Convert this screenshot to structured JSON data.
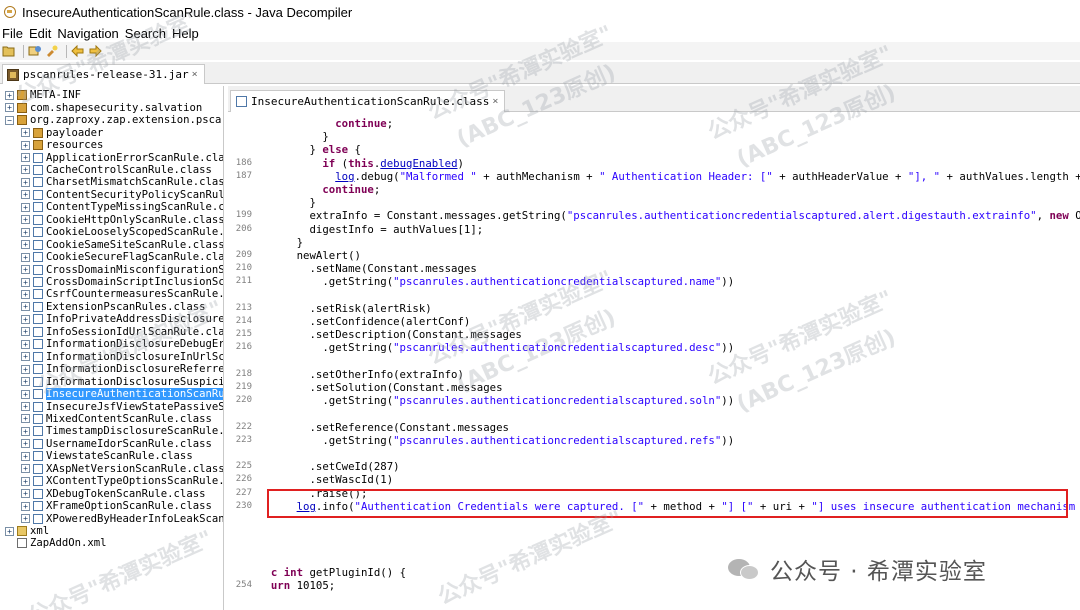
{
  "window": {
    "title": "InsecureAuthenticationScanRule.class - Java Decompiler"
  },
  "menu": {
    "items": [
      "File",
      "Edit",
      "Navigation",
      "Search",
      "Help"
    ]
  },
  "file_tab": {
    "label": "pscanrules-release-31.jar",
    "close": "×"
  },
  "tree": {
    "nodes": [
      {
        "label": "META-INF",
        "exp": "+",
        "icon": "package-icon"
      },
      {
        "label": "com.shapesecurity.salvation",
        "exp": "+",
        "icon": "package-icon"
      },
      {
        "label": "org.zaproxy.zap.extension.psca",
        "exp": "−",
        "icon": "package-icon"
      },
      {
        "label": "payloader",
        "exp": "+",
        "icon": "package-icon"
      },
      {
        "label": "resources",
        "exp": "+",
        "icon": "package-icon"
      },
      {
        "label": "ApplicationErrorScanRule.cla",
        "exp": "+",
        "icon": "class-icon"
      },
      {
        "label": "CacheControlScanRule.class",
        "exp": "+",
        "icon": "class-icon"
      },
      {
        "label": "CharsetMismatchScanRule.clas",
        "exp": "+",
        "icon": "class-icon"
      },
      {
        "label": "ContentSecurityPolicyScanRul",
        "exp": "+",
        "icon": "class-icon"
      },
      {
        "label": "ContentTypeMissingScanRule.c",
        "exp": "+",
        "icon": "class-icon"
      },
      {
        "label": "CookieHttpOnlyScanRule.class",
        "exp": "+",
        "icon": "class-icon"
      },
      {
        "label": "CookieLooselyScopedScanRule.",
        "exp": "+",
        "icon": "class-icon"
      },
      {
        "label": "CookieSameSiteScanRule.class",
        "exp": "+",
        "icon": "class-icon"
      },
      {
        "label": "CookieSecureFlagScanRule.cla",
        "exp": "+",
        "icon": "class-icon"
      },
      {
        "label": "CrossDomainMisconfigurationS",
        "exp": "+",
        "icon": "class-icon"
      },
      {
        "label": "CrossDomainScriptInclusionSc",
        "exp": "+",
        "icon": "class-icon"
      },
      {
        "label": "CsrfCountermeasuresScanRule.",
        "exp": "+",
        "icon": "class-icon"
      },
      {
        "label": "ExtensionPscanRules.class",
        "exp": "+",
        "icon": "class-icon"
      },
      {
        "label": "InfoPrivateAddressDisclosure",
        "exp": "+",
        "icon": "class-icon"
      },
      {
        "label": "InfoSessionIdUrlScanRule.cla",
        "exp": "+",
        "icon": "class-icon"
      },
      {
        "label": "InformationDisclosureDebugEr",
        "exp": "+",
        "icon": "class-icon"
      },
      {
        "label": "InformationDisclosureInUrlSc",
        "exp": "+",
        "icon": "class-icon"
      },
      {
        "label": "InformationDisclosureReferre",
        "exp": "+",
        "icon": "class-icon"
      },
      {
        "label": "InformationDisclosureSuspici",
        "exp": "+",
        "icon": "class-icon"
      },
      {
        "label": "InsecureAuthenticationScanRu",
        "exp": "+",
        "icon": "class-icon",
        "selected": true
      },
      {
        "label": "InsecureJsfViewStatePassiveS",
        "exp": "+",
        "icon": "class-icon"
      },
      {
        "label": "MixedContentScanRule.class",
        "exp": "+",
        "icon": "class-icon"
      },
      {
        "label": "TimestampDisclosureScanRule.",
        "exp": "+",
        "icon": "class-icon"
      },
      {
        "label": "UsernameIdorScanRule.class",
        "exp": "+",
        "icon": "class-icon"
      },
      {
        "label": "ViewstateScanRule.class",
        "exp": "+",
        "icon": "class-icon"
      },
      {
        "label": "XAspNetVersionScanRule.class",
        "exp": "+",
        "icon": "class-icon"
      },
      {
        "label": "XContentTypeOptionsScanRule.",
        "exp": "+",
        "icon": "class-icon"
      },
      {
        "label": "XDebugTokenScanRule.class",
        "exp": "+",
        "icon": "class-icon"
      },
      {
        "label": "XFrameOptionScanRule.class",
        "exp": "+",
        "icon": "class-icon"
      },
      {
        "label": "XPoweredByHeaderInfoLeakScan",
        "exp": "+",
        "icon": "class-icon"
      },
      {
        "label": "xml",
        "exp": "+",
        "icon": "folder-icon"
      },
      {
        "label": "ZapAddOn.xml",
        "exp": "",
        "icon": "xml-icon"
      }
    ]
  },
  "editor_tab": {
    "label": "InsecureAuthenticationScanRule.class",
    "close": "×"
  },
  "code": [
    {
      "ln": "",
      "segs": [
        {
          "t": "            "
        },
        {
          "t": "continue",
          "c": "kw"
        },
        {
          "t": ";"
        }
      ]
    },
    {
      "ln": "",
      "segs": [
        {
          "t": "          }"
        }
      ]
    },
    {
      "ln": "",
      "segs": [
        {
          "t": "        } "
        },
        {
          "t": "else",
          "c": "kw"
        },
        {
          "t": " {"
        }
      ]
    },
    {
      "ln": "186",
      "segs": [
        {
          "t": "          "
        },
        {
          "t": "if",
          "c": "kw"
        },
        {
          "t": " ("
        },
        {
          "t": "this",
          "c": "kw"
        },
        {
          "t": "."
        },
        {
          "t": "debugEnabled",
          "c": "fld ul"
        },
        {
          "t": ")"
        }
      ]
    },
    {
      "ln": "187",
      "segs": [
        {
          "t": "            "
        },
        {
          "t": "log",
          "c": "fld ul"
        },
        {
          "t": ".debug("
        },
        {
          "t": "\"Malformed \"",
          "c": "str"
        },
        {
          "t": " + authMechanism + "
        },
        {
          "t": "\" Authentication Header: [\"",
          "c": "str"
        },
        {
          "t": " + authHeaderValue + "
        },
        {
          "t": "\"], \"",
          "c": "str"
        },
        {
          "t": " + authValues.length + "
        },
        {
          "t": "\" valu",
          "c": "str"
        }
      ]
    },
    {
      "ln": "",
      "segs": [
        {
          "t": "          "
        },
        {
          "t": "continue",
          "c": "kw"
        },
        {
          "t": ";"
        }
      ]
    },
    {
      "ln": "",
      "segs": [
        {
          "t": "        }"
        }
      ]
    },
    {
      "ln": "199",
      "segs": [
        {
          "t": "        extraInfo = Constant.messages.getString("
        },
        {
          "t": "\"pscanrules.authenticationcredentialscaptured.alert.digestauth.extrainfo\"",
          "c": "str"
        },
        {
          "t": ", "
        },
        {
          "t": "new",
          "c": "kw"
        },
        {
          "t": " Object[]"
        }
      ]
    },
    {
      "ln": "206",
      "segs": [
        {
          "t": "        digestInfo = authValues[1];"
        }
      ]
    },
    {
      "ln": "",
      "segs": [
        {
          "t": "      }"
        }
      ]
    },
    {
      "ln": "209",
      "segs": [
        {
          "t": "      newAlert()"
        }
      ]
    },
    {
      "ln": "210",
      "segs": [
        {
          "t": "        .setName(Constant.messages"
        }
      ]
    },
    {
      "ln": "211",
      "segs": [
        {
          "t": "          .getString("
        },
        {
          "t": "\"pscanrules.authenticationcredentialscaptured.name\"",
          "c": "str"
        },
        {
          "t": "))"
        }
      ]
    },
    {
      "ln": "",
      "segs": [
        {
          "t": ""
        }
      ]
    },
    {
      "ln": "213",
      "segs": [
        {
          "t": "        .setRisk(alertRisk)"
        }
      ]
    },
    {
      "ln": "214",
      "segs": [
        {
          "t": "        .setConfidence(alertConf)"
        }
      ]
    },
    {
      "ln": "215",
      "segs": [
        {
          "t": "        .setDescription(Constant.messages"
        }
      ]
    },
    {
      "ln": "216",
      "segs": [
        {
          "t": "          .getString("
        },
        {
          "t": "\"pscanrules.authenticationcredentialscaptured.desc\"",
          "c": "str"
        },
        {
          "t": "))"
        }
      ]
    },
    {
      "ln": "",
      "segs": [
        {
          "t": ""
        }
      ]
    },
    {
      "ln": "218",
      "segs": [
        {
          "t": "        .setOtherInfo(extraInfo)"
        }
      ]
    },
    {
      "ln": "219",
      "segs": [
        {
          "t": "        .setSolution(Constant.messages"
        }
      ]
    },
    {
      "ln": "220",
      "segs": [
        {
          "t": "          .getString("
        },
        {
          "t": "\"pscanrules.authenticationcredentialscaptured.soln\"",
          "c": "str"
        },
        {
          "t": "))"
        }
      ]
    },
    {
      "ln": "",
      "segs": [
        {
          "t": ""
        }
      ]
    },
    {
      "ln": "222",
      "segs": [
        {
          "t": "        .setReference(Constant.messages"
        }
      ]
    },
    {
      "ln": "223",
      "segs": [
        {
          "t": "          .getString("
        },
        {
          "t": "\"pscanrules.authenticationcredentialscaptured.refs\"",
          "c": "str"
        },
        {
          "t": "))"
        }
      ]
    },
    {
      "ln": "",
      "segs": [
        {
          "t": ""
        }
      ]
    },
    {
      "ln": "225",
      "segs": [
        {
          "t": "        .setCweId(287)"
        }
      ]
    },
    {
      "ln": "226",
      "segs": [
        {
          "t": "        .setWascId(1)"
        }
      ]
    },
    {
      "ln": "227",
      "segs": [
        {
          "t": "        .raise();"
        }
      ]
    },
    {
      "ln": "230",
      "segs": [
        {
          "t": "      "
        },
        {
          "t": "log",
          "c": "fld ul"
        },
        {
          "t": ".info("
        },
        {
          "t": "\"Authentication Credentials were captured. [\"",
          "c": "str"
        },
        {
          "t": " + method + "
        },
        {
          "t": "\"] [\"",
          "c": "str"
        },
        {
          "t": " + uri + "
        },
        {
          "t": "\"] uses insecure authentication mechanism [\"",
          "c": "str"
        },
        {
          "t": " + au"
        }
      ]
    },
    {
      "ln": "",
      "segs": [
        {
          "t": ""
        }
      ]
    },
    {
      "ln": "",
      "segs": [
        {
          "t": ""
        }
      ]
    },
    {
      "ln": "",
      "segs": [
        {
          "t": ""
        }
      ]
    },
    {
      "ln": "",
      "segs": [
        {
          "t": ""
        }
      ]
    },
    {
      "ln": "",
      "segs": [
        {
          "t": "  "
        },
        {
          "t": "c",
          "c": "kw"
        },
        {
          "t": " "
        },
        {
          "t": "int",
          "c": "kw"
        },
        {
          "t": " getPluginId() {"
        }
      ]
    },
    {
      "ln": "254",
      "segs": [
        {
          "t": "  "
        },
        {
          "t": "urn",
          "c": "kw"
        },
        {
          "t": " 10105;"
        }
      ]
    }
  ],
  "watermark": {
    "line1": "公众号\"希潭实验室\"",
    "line2": "(ABC_123原创)"
  },
  "brand": {
    "text": "公众号 · 希潭实验室"
  }
}
